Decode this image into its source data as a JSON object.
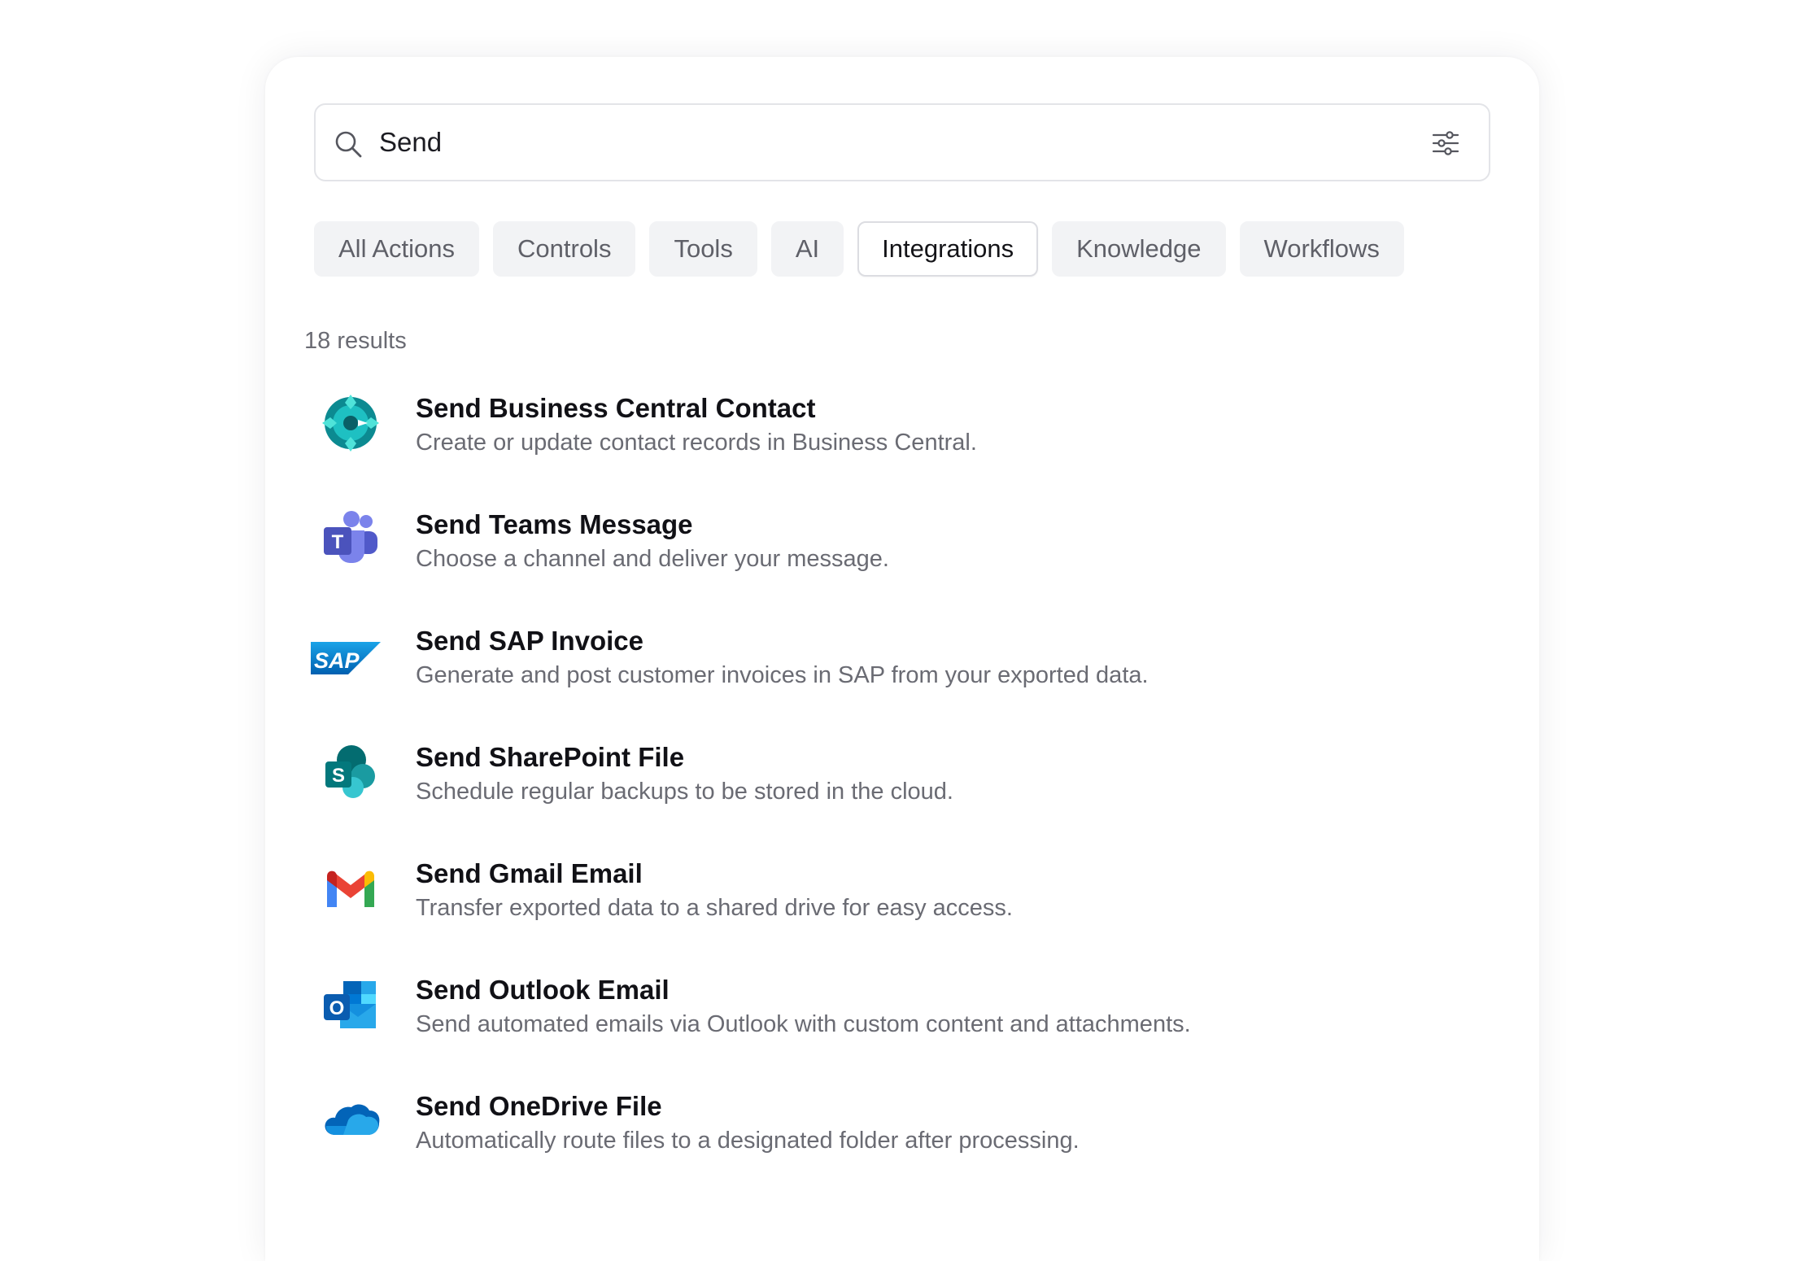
{
  "search": {
    "value": "Send",
    "icon": "search-icon",
    "filter_icon": "sliders-icon"
  },
  "tabs": [
    {
      "label": "All Actions",
      "active": false
    },
    {
      "label": "Controls",
      "active": false
    },
    {
      "label": "Tools",
      "active": false
    },
    {
      "label": "AI",
      "active": false
    },
    {
      "label": "Integrations",
      "active": true
    },
    {
      "label": "Knowledge",
      "active": false
    },
    {
      "label": "Workflows",
      "active": false
    }
  ],
  "results": {
    "count_label": "18 results",
    "items": [
      {
        "title": "Send Business Central Contact",
        "description": "Create or update contact records in Business Central.",
        "icon": "business-central-icon"
      },
      {
        "title": "Send Teams Message",
        "description": "Choose a channel and deliver your message.",
        "icon": "teams-icon"
      },
      {
        "title": "Send SAP Invoice",
        "description": "Generate and post customer invoices in SAP from your exported data.",
        "icon": "sap-icon"
      },
      {
        "title": "Send SharePoint File",
        "description": "Schedule regular backups to be stored in the cloud.",
        "icon": "sharepoint-icon"
      },
      {
        "title": "Send Gmail Email",
        "description": "Transfer exported data to a shared drive for easy access.",
        "icon": "gmail-icon"
      },
      {
        "title": "Send Outlook Email",
        "description": "Send automated emails via Outlook with custom content and attachments.",
        "icon": "outlook-icon"
      },
      {
        "title": "Send OneDrive File",
        "description": "Automatically route files to a designated folder after processing.",
        "icon": "onedrive-icon"
      }
    ]
  },
  "icon_letters": {
    "teams": "T",
    "sap": "SAP",
    "sharepoint": "S",
    "outlook": "O"
  },
  "colors": {
    "text_primary": "#111116",
    "text_secondary": "#6a6b73",
    "tab_bg": "#f2f3f5",
    "border": "#e3e4e8"
  }
}
